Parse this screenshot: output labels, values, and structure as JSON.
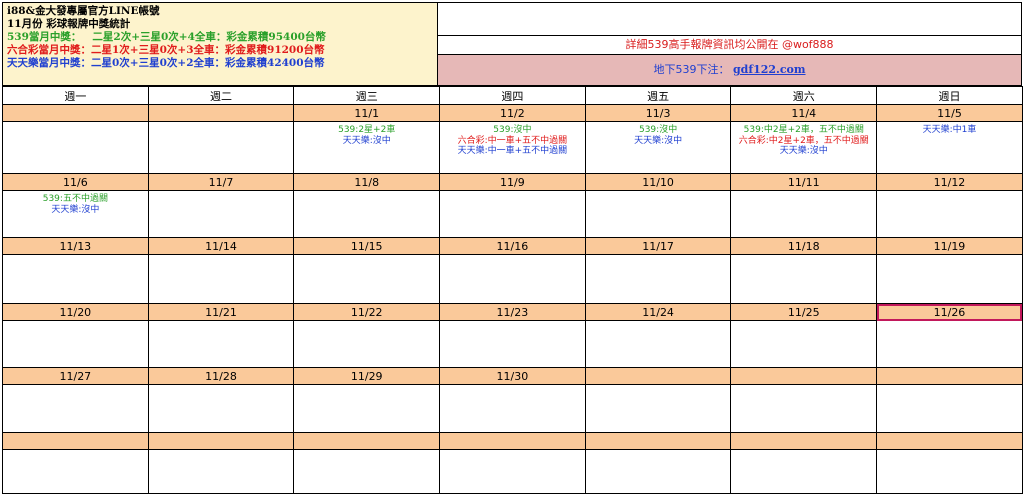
{
  "header": {
    "title_line1": "i88&金大發專屬官方LINE帳號",
    "title_line2": "11月份 彩球報牌中獎統計",
    "stats": [
      {
        "label": "539當月中獎：",
        "detail": "二星2次+三星0次+4全車：彩金累積95400台幣",
        "color": "#2aa02a"
      },
      {
        "label": "六合彩當月中獎：",
        "detail": "二星1次+三星0次+3全車：彩金累積91200台幣",
        "color": "#e01b1b"
      },
      {
        "label": "天天樂當月中獎：",
        "detail": "二星0次+三星0次+2全車：彩金累積42400台幣",
        "color": "#1f3fd0"
      }
    ],
    "announcement": "詳細539高手報牌資訊均公開在 @wof888",
    "link_prefix": "地下539下注：",
    "link_text": "gdf122.com"
  },
  "calendar": {
    "weekdays": [
      "週一",
      "週二",
      "週三",
      "週四",
      "週五",
      "週六",
      "週日"
    ],
    "weeks": [
      {
        "dates": [
          "",
          "",
          "11/1",
          "11/2",
          "11/3",
          "11/4",
          "11/5"
        ],
        "notes": [
          [],
          [],
          [
            {
              "text": "539:2星+2車",
              "color": "#2aa02a"
            },
            {
              "text": "天天樂:沒中",
              "color": "#1f3fd0"
            }
          ],
          [
            {
              "text": "539:沒中",
              "color": "#2aa02a"
            },
            {
              "text": "六合彩:中一車+五不中過關",
              "color": "#e01b1b"
            },
            {
              "text": "天天樂:中一車+五不中過關",
              "color": "#1f3fd0"
            }
          ],
          [
            {
              "text": "539:沒中",
              "color": "#2aa02a"
            },
            {
              "text": "天天樂:沒中",
              "color": "#1f3fd0"
            }
          ],
          [
            {
              "text": "539:中2星+2車，五不中過關",
              "color": "#2aa02a"
            },
            {
              "text": "六合彩:中2星+2車，五不中過關",
              "color": "#e01b1b"
            },
            {
              "text": "天天樂:沒中",
              "color": "#1f3fd0"
            }
          ],
          [
            {
              "text": "天天樂:中1車",
              "color": "#1f3fd0"
            }
          ]
        ]
      },
      {
        "dates": [
          "11/6",
          "11/7",
          "11/8",
          "11/9",
          "11/10",
          "11/11",
          "11/12"
        ],
        "notes": [
          [
            {
              "text": "539:五不中過關",
              "color": "#2aa02a"
            },
            {
              "text": "天天樂:沒中",
              "color": "#1f3fd0"
            }
          ],
          [],
          [],
          [],
          [],
          [],
          []
        ]
      },
      {
        "dates": [
          "11/13",
          "11/14",
          "11/15",
          "11/16",
          "11/17",
          "11/18",
          "11/19"
        ],
        "notes": [
          [],
          [],
          [],
          [],
          [],
          [],
          []
        ]
      },
      {
        "dates": [
          "11/20",
          "11/21",
          "11/22",
          "11/23",
          "11/24",
          "11/25",
          "11/26"
        ],
        "notes": [
          [],
          [],
          [],
          [],
          [],
          [],
          []
        ]
      },
      {
        "dates": [
          "11/27",
          "11/28",
          "11/29",
          "11/30",
          "",
          "",
          ""
        ],
        "notes": [
          [],
          [],
          [],
          [],
          [],
          [],
          []
        ]
      },
      {
        "dates": [
          "",
          "",
          "",
          "",
          "",
          "",
          ""
        ],
        "notes": [
          [],
          [],
          [],
          [],
          [],
          [],
          []
        ]
      }
    ],
    "selected_cell": "11/26",
    "colors": {
      "date_row_bg": "#fac99a",
      "header_left_bg": "#fdf3cc",
      "link_row_bg": "#e6b8b7",
      "selection_border": "#c2185b"
    }
  }
}
